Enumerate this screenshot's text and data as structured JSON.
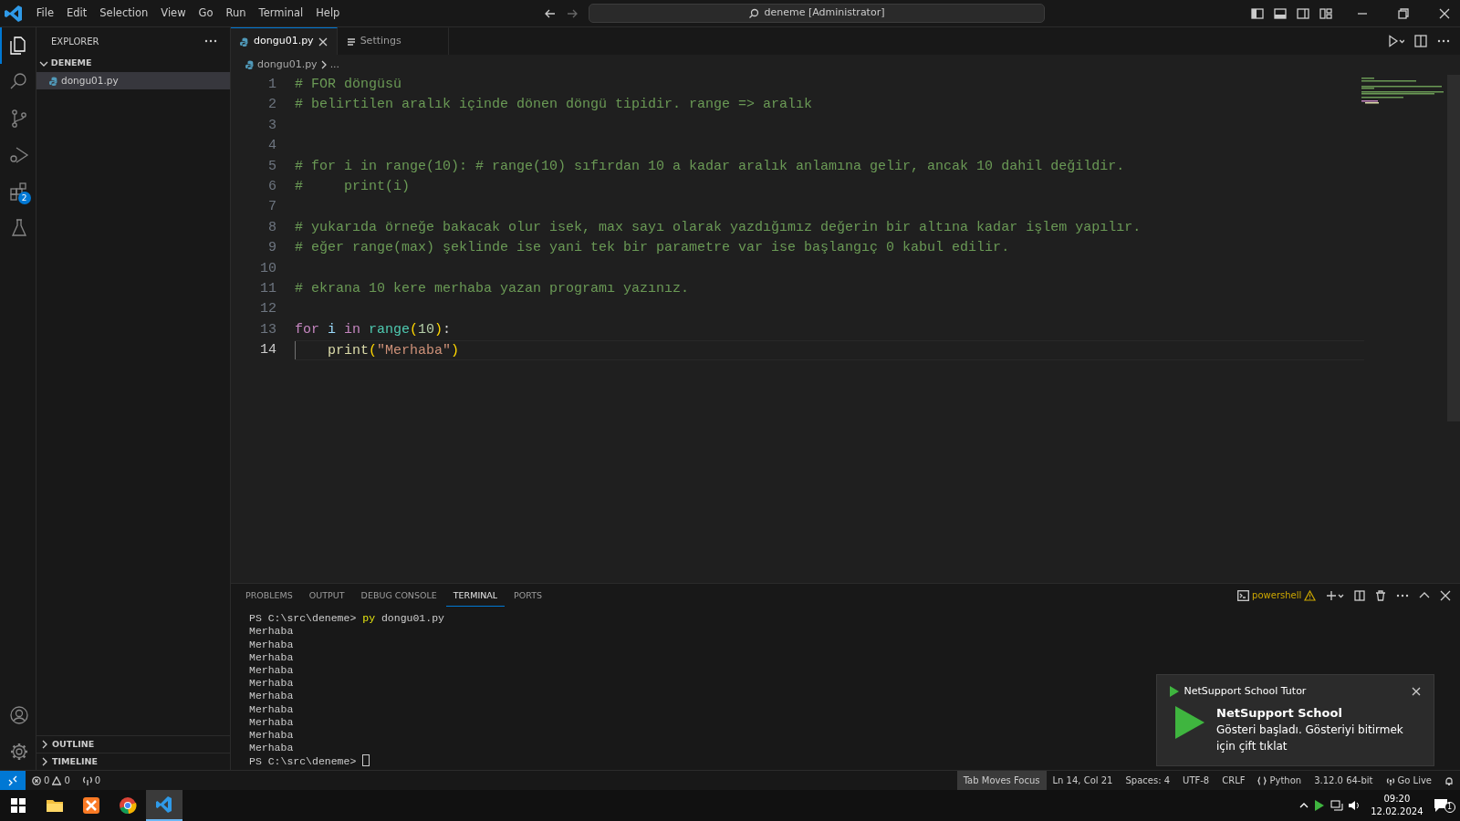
{
  "title_bar": {
    "menu": [
      "File",
      "Edit",
      "Selection",
      "View",
      "Go",
      "Run",
      "Terminal",
      "Help"
    ],
    "search": "deneme [Administrator]"
  },
  "activity_bar": {
    "items": [
      {
        "kind": "explorer",
        "selected": true
      },
      {
        "kind": "search",
        "selected": false
      },
      {
        "kind": "source-control",
        "selected": false
      },
      {
        "kind": "run",
        "selected": false
      },
      {
        "kind": "extensions",
        "selected": false,
        "badge": "2"
      },
      {
        "kind": "testing",
        "selected": false
      }
    ],
    "bottom": [
      {
        "kind": "account"
      },
      {
        "kind": "settings"
      }
    ]
  },
  "sidebar": {
    "title": "EXPLORER",
    "folder": {
      "name": "DENEME",
      "expanded": true,
      "files": [
        {
          "name": "dongu01.py",
          "selected": true
        }
      ]
    },
    "sections": [
      {
        "name": "OUTLINE",
        "expanded": false
      },
      {
        "name": "TIMELINE",
        "expanded": false
      }
    ]
  },
  "editor": {
    "tabs": [
      {
        "label": "dongu01.py",
        "kind": "python",
        "selected": true
      },
      {
        "label": "Settings",
        "kind": "settings",
        "selected": false
      }
    ],
    "breadcrumb": [
      "dongu01.py",
      "..."
    ],
    "lines": [
      {
        "number": "1",
        "current": false,
        "tokens": [
          {
            "kind": "comment",
            "text": "# FOR döngüsü"
          }
        ]
      },
      {
        "number": "2",
        "current": false,
        "tokens": [
          {
            "kind": "comment",
            "text": "# belirtilen aralık içinde dönen döngü tipidir. range => aralık"
          }
        ]
      },
      {
        "number": "3",
        "current": false
      },
      {
        "number": "4",
        "current": false
      },
      {
        "number": "5",
        "current": false,
        "tokens": [
          {
            "kind": "comment",
            "text": "# for i in range(10): # range(10) sıfırdan 10 a kadar aralık anlamına gelir, ancak 10 dahil değildir."
          }
        ]
      },
      {
        "number": "6",
        "current": false,
        "tokens": [
          {
            "kind": "comment",
            "text": "#     print(i)"
          }
        ]
      },
      {
        "number": "7",
        "current": false
      },
      {
        "number": "8",
        "current": false,
        "tokens": [
          {
            "kind": "comment",
            "text": "# yukarıda örneğe bakacak olur isek, max sayı olarak yazdığımız değerin bir altına kadar işlem yapılır."
          }
        ]
      },
      {
        "number": "9",
        "current": false,
        "tokens": [
          {
            "kind": "comment",
            "text": "# eğer range(max) şeklinde ise yani tek bir parametre var ise başlangıç 0 kabul edilir."
          }
        ]
      },
      {
        "number": "10",
        "current": false
      },
      {
        "number": "11",
        "current": false,
        "tokens": [
          {
            "kind": "comment",
            "text": "# ekrana 10 kere merhaba yazan programı yazınız."
          }
        ]
      },
      {
        "number": "12",
        "current": false
      },
      {
        "number": "13",
        "current": false,
        "tokens": [
          {
            "kind": "keyword",
            "text": "for "
          },
          {
            "kind": "variable",
            "text": "i "
          },
          {
            "kind": "keyword",
            "text": "in "
          },
          {
            "kind": "type",
            "text": "range"
          },
          {
            "kind": "bracket",
            "text": "("
          },
          {
            "kind": "number",
            "text": "10"
          },
          {
            "kind": "bracket",
            "text": ")"
          },
          {
            "kind": "plain",
            "text": ":"
          }
        ]
      },
      {
        "number": "14",
        "current": true,
        "indented": true,
        "tokens": [
          {
            "kind": "function",
            "text": "print"
          },
          {
            "kind": "bracket",
            "text": "("
          },
          {
            "kind": "string",
            "text": "\"Merhaba\""
          },
          {
            "kind": "bracket",
            "text": ")"
          }
        ]
      }
    ]
  },
  "panel": {
    "tabs": [
      {
        "label": "PROBLEMS",
        "selected": false
      },
      {
        "label": "OUTPUT",
        "selected": false
      },
      {
        "label": "DEBUG CONSOLE",
        "selected": false
      },
      {
        "label": "TERMINAL",
        "selected": true
      },
      {
        "label": "PORTS",
        "selected": false
      }
    ],
    "terminal_profile": "powershell",
    "terminal_lines": [
      [
        {
          "kind": "plain",
          "text": "PS C:\\src\\deneme> "
        },
        {
          "kind": "command",
          "text": "py"
        },
        {
          "kind": "plain",
          "text": " dongu01.py"
        }
      ],
      [
        {
          "kind": "plain",
          "text": "Merhaba"
        }
      ],
      [
        {
          "kind": "plain",
          "text": "Merhaba"
        }
      ],
      [
        {
          "kind": "plain",
          "text": "Merhaba"
        }
      ],
      [
        {
          "kind": "plain",
          "text": "Merhaba"
        }
      ],
      [
        {
          "kind": "plain",
          "text": "Merhaba"
        }
      ],
      [
        {
          "kind": "plain",
          "text": "Merhaba"
        }
      ],
      [
        {
          "kind": "plain",
          "text": "Merhaba"
        }
      ],
      [
        {
          "kind": "plain",
          "text": "Merhaba"
        }
      ],
      [
        {
          "kind": "plain",
          "text": "Merhaba"
        }
      ],
      [
        {
          "kind": "plain",
          "text": "Merhaba"
        }
      ],
      [
        {
          "kind": "plain",
          "text": "PS C:\\src\\deneme> "
        },
        {
          "kind": "cursor"
        }
      ]
    ]
  },
  "notification": {
    "app": "NetSupport School Tutor",
    "title": "NetSupport School",
    "message": "Gösteri başladı. Gösteriyi bitirmek için çift tıklat"
  },
  "status_bar": {
    "errors": "0",
    "warnings": "0",
    "ports": "0",
    "items": [
      {
        "text": "Tab Moves Focus",
        "highlighted": true
      },
      {
        "text": "Ln 14, Col 21",
        "highlighted": false
      },
      {
        "text": "Spaces: 4",
        "highlighted": false
      },
      {
        "text": "UTF-8",
        "highlighted": false
      },
      {
        "text": "CRLF",
        "highlighted": false
      },
      {
        "text": "Python",
        "highlighted": false,
        "kind": "language"
      },
      {
        "text": "3.12.0 64-bit",
        "highlighted": false
      },
      {
        "text": "Go Live",
        "highlighted": false,
        "kind": "live"
      }
    ]
  },
  "taskbar": {
    "apps": [
      {
        "kind": "start",
        "selected": false
      },
      {
        "kind": "files",
        "selected": false
      },
      {
        "kind": "xampp",
        "selected": false
      },
      {
        "kind": "browser",
        "selected": false
      },
      {
        "kind": "vscode",
        "selected": true
      }
    ],
    "time": "09:20",
    "date": "12.02.2024",
    "notifications": "1"
  }
}
